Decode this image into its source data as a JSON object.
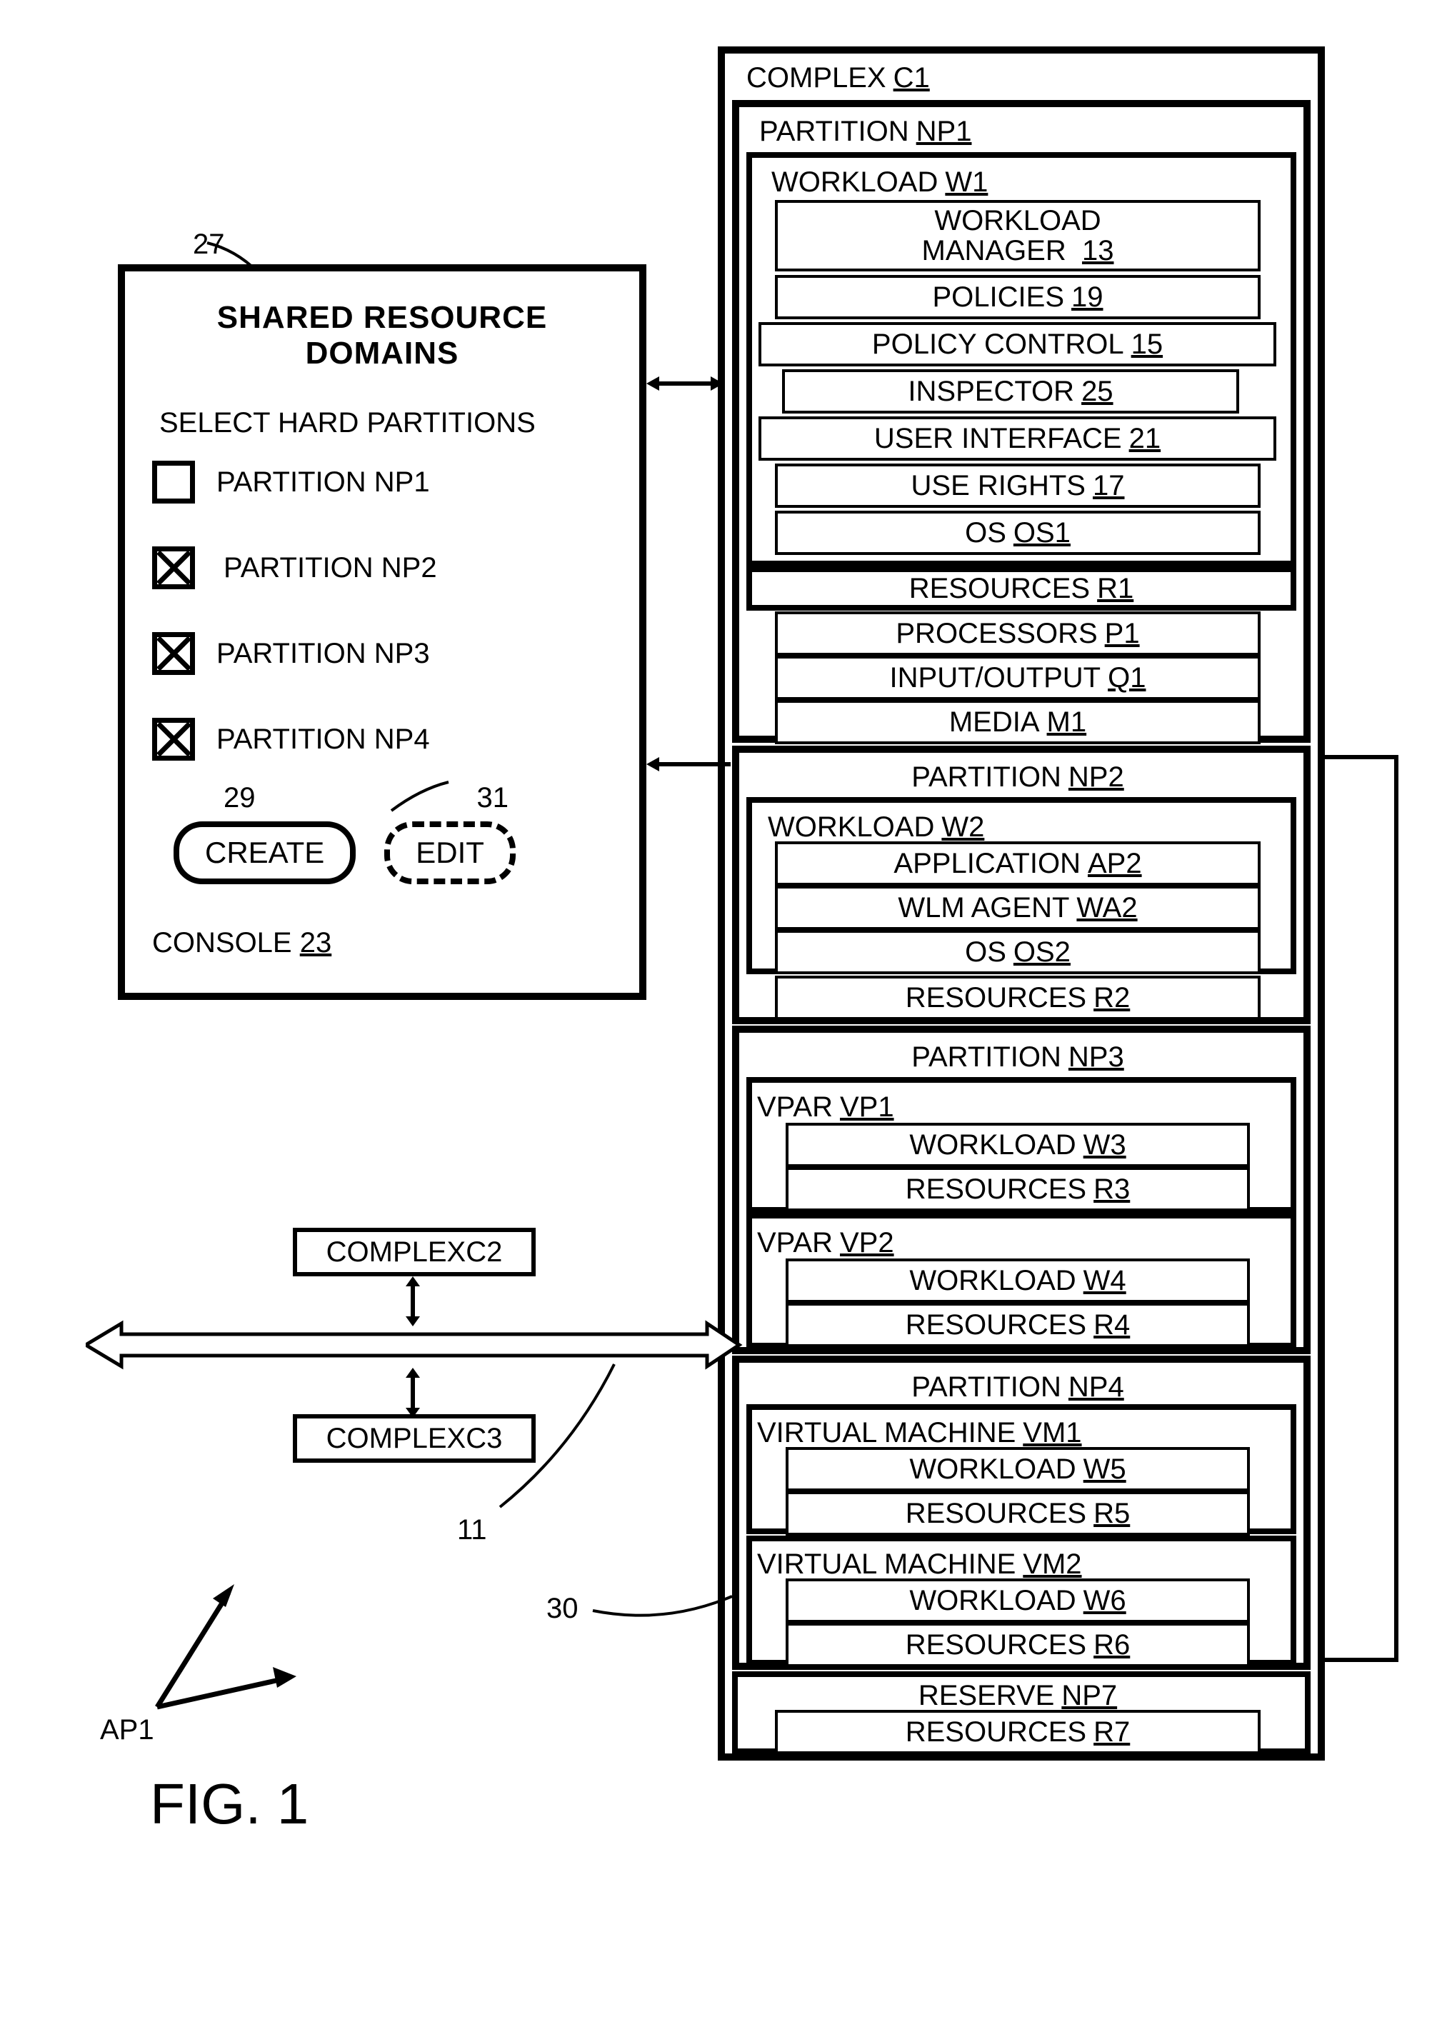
{
  "figure_label": "FIG. 1",
  "ap1_label": "AP1",
  "console": {
    "ref_27": "27",
    "title": "SHARED RESOURCE DOMAINS",
    "subtitle": "SELECT HARD PARTITIONS",
    "items": [
      {
        "label": "PARTITION NP1",
        "checked": false
      },
      {
        "label": "PARTITION NP2",
        "checked": true
      },
      {
        "label": "PARTITION NP3",
        "checked": true
      },
      {
        "label": "PARTITION NP4",
        "checked": true
      }
    ],
    "ref_29": "29",
    "ref_31": "31",
    "create_label": "CREATE",
    "edit_label": "EDIT",
    "footer": "CONSOLE",
    "footer_ref": "23"
  },
  "ref_11": "11",
  "ref_30": "30",
  "complex_c2_pre": "COMPLEX",
  "complex_c2_ref": "C2",
  "complex_c3_pre": "COMPLEX",
  "complex_c3_ref": "C3",
  "tree": {
    "c1_pre": "COMPLEX",
    "c1_ref": "C1",
    "np1_pre": "PARTITION",
    "np1_ref": "NP1",
    "w1_pre": "WORKLOAD",
    "w1_ref": "W1",
    "wm_pre": "WORKLOAD MANAGER",
    "wm_ref": "13",
    "pol_pre": "POLICIES",
    "pol_ref": "19",
    "pc_pre": "POLICY CONTROL",
    "pc_ref": "15",
    "insp_pre": "INSPECTOR",
    "insp_ref": "25",
    "ui_pre": "USER INTERFACE",
    "ui_ref": "21",
    "ur_pre": "USE RIGHTS",
    "ur_ref": "17",
    "os1_pre": "OS",
    "os1_ref": "OS1",
    "r1_pre": "RESOURCES",
    "r1_ref": "R1",
    "p1_pre": "PROCESSORS",
    "p1_ref": "P1",
    "io_pre": "INPUT/OUTPUT",
    "io_ref": "Q1",
    "m1_pre": "MEDIA",
    "m1_ref": "M1",
    "np2_pre": "PARTITION",
    "np2_ref": "NP2",
    "w2_pre": "WORKLOAD",
    "w2_ref": "W2",
    "ap2_pre": "APPLICATION",
    "ap2_ref": "AP2",
    "wa2_pre": "WLM AGENT",
    "wa2_ref": "WA2",
    "os2_pre": "OS",
    "os2_ref": "OS2",
    "r2_pre": "RESOURCES",
    "r2_ref": "R2",
    "np3_pre": "PARTITION",
    "np3_ref": "NP3",
    "vp1_pre": "VPAR",
    "vp1_ref": "VP1",
    "w3_pre": "WORKLOAD",
    "w3_ref": "W3",
    "r3_pre": "RESOURCES",
    "r3_ref": "R3",
    "vp2_pre": "VPAR",
    "vp2_ref": "VP2",
    "w4_pre": "WORKLOAD",
    "w4_ref": "W4",
    "r4_pre": "RESOURCES",
    "r4_ref": "R4",
    "np4_pre": "PARTITION",
    "np4_ref": "NP4",
    "vm1_pre": "VIRTUAL MACHINE",
    "vm1_ref": "VM1",
    "w5_pre": "WORKLOAD",
    "w5_ref": "W5",
    "r5_pre": "RESOURCES",
    "r5_ref": "R5",
    "vm2_pre": "VIRTUAL MACHINE",
    "vm2_ref": "VM2",
    "w6_pre": "WORKLOAD",
    "w6_ref": "W6",
    "r6_pre": "RESOURCES",
    "r6_ref": "R6",
    "np7_pre": "RESERVE",
    "np7_ref": "NP7",
    "r7_pre": "RESOURCES",
    "r7_ref": "R7"
  }
}
